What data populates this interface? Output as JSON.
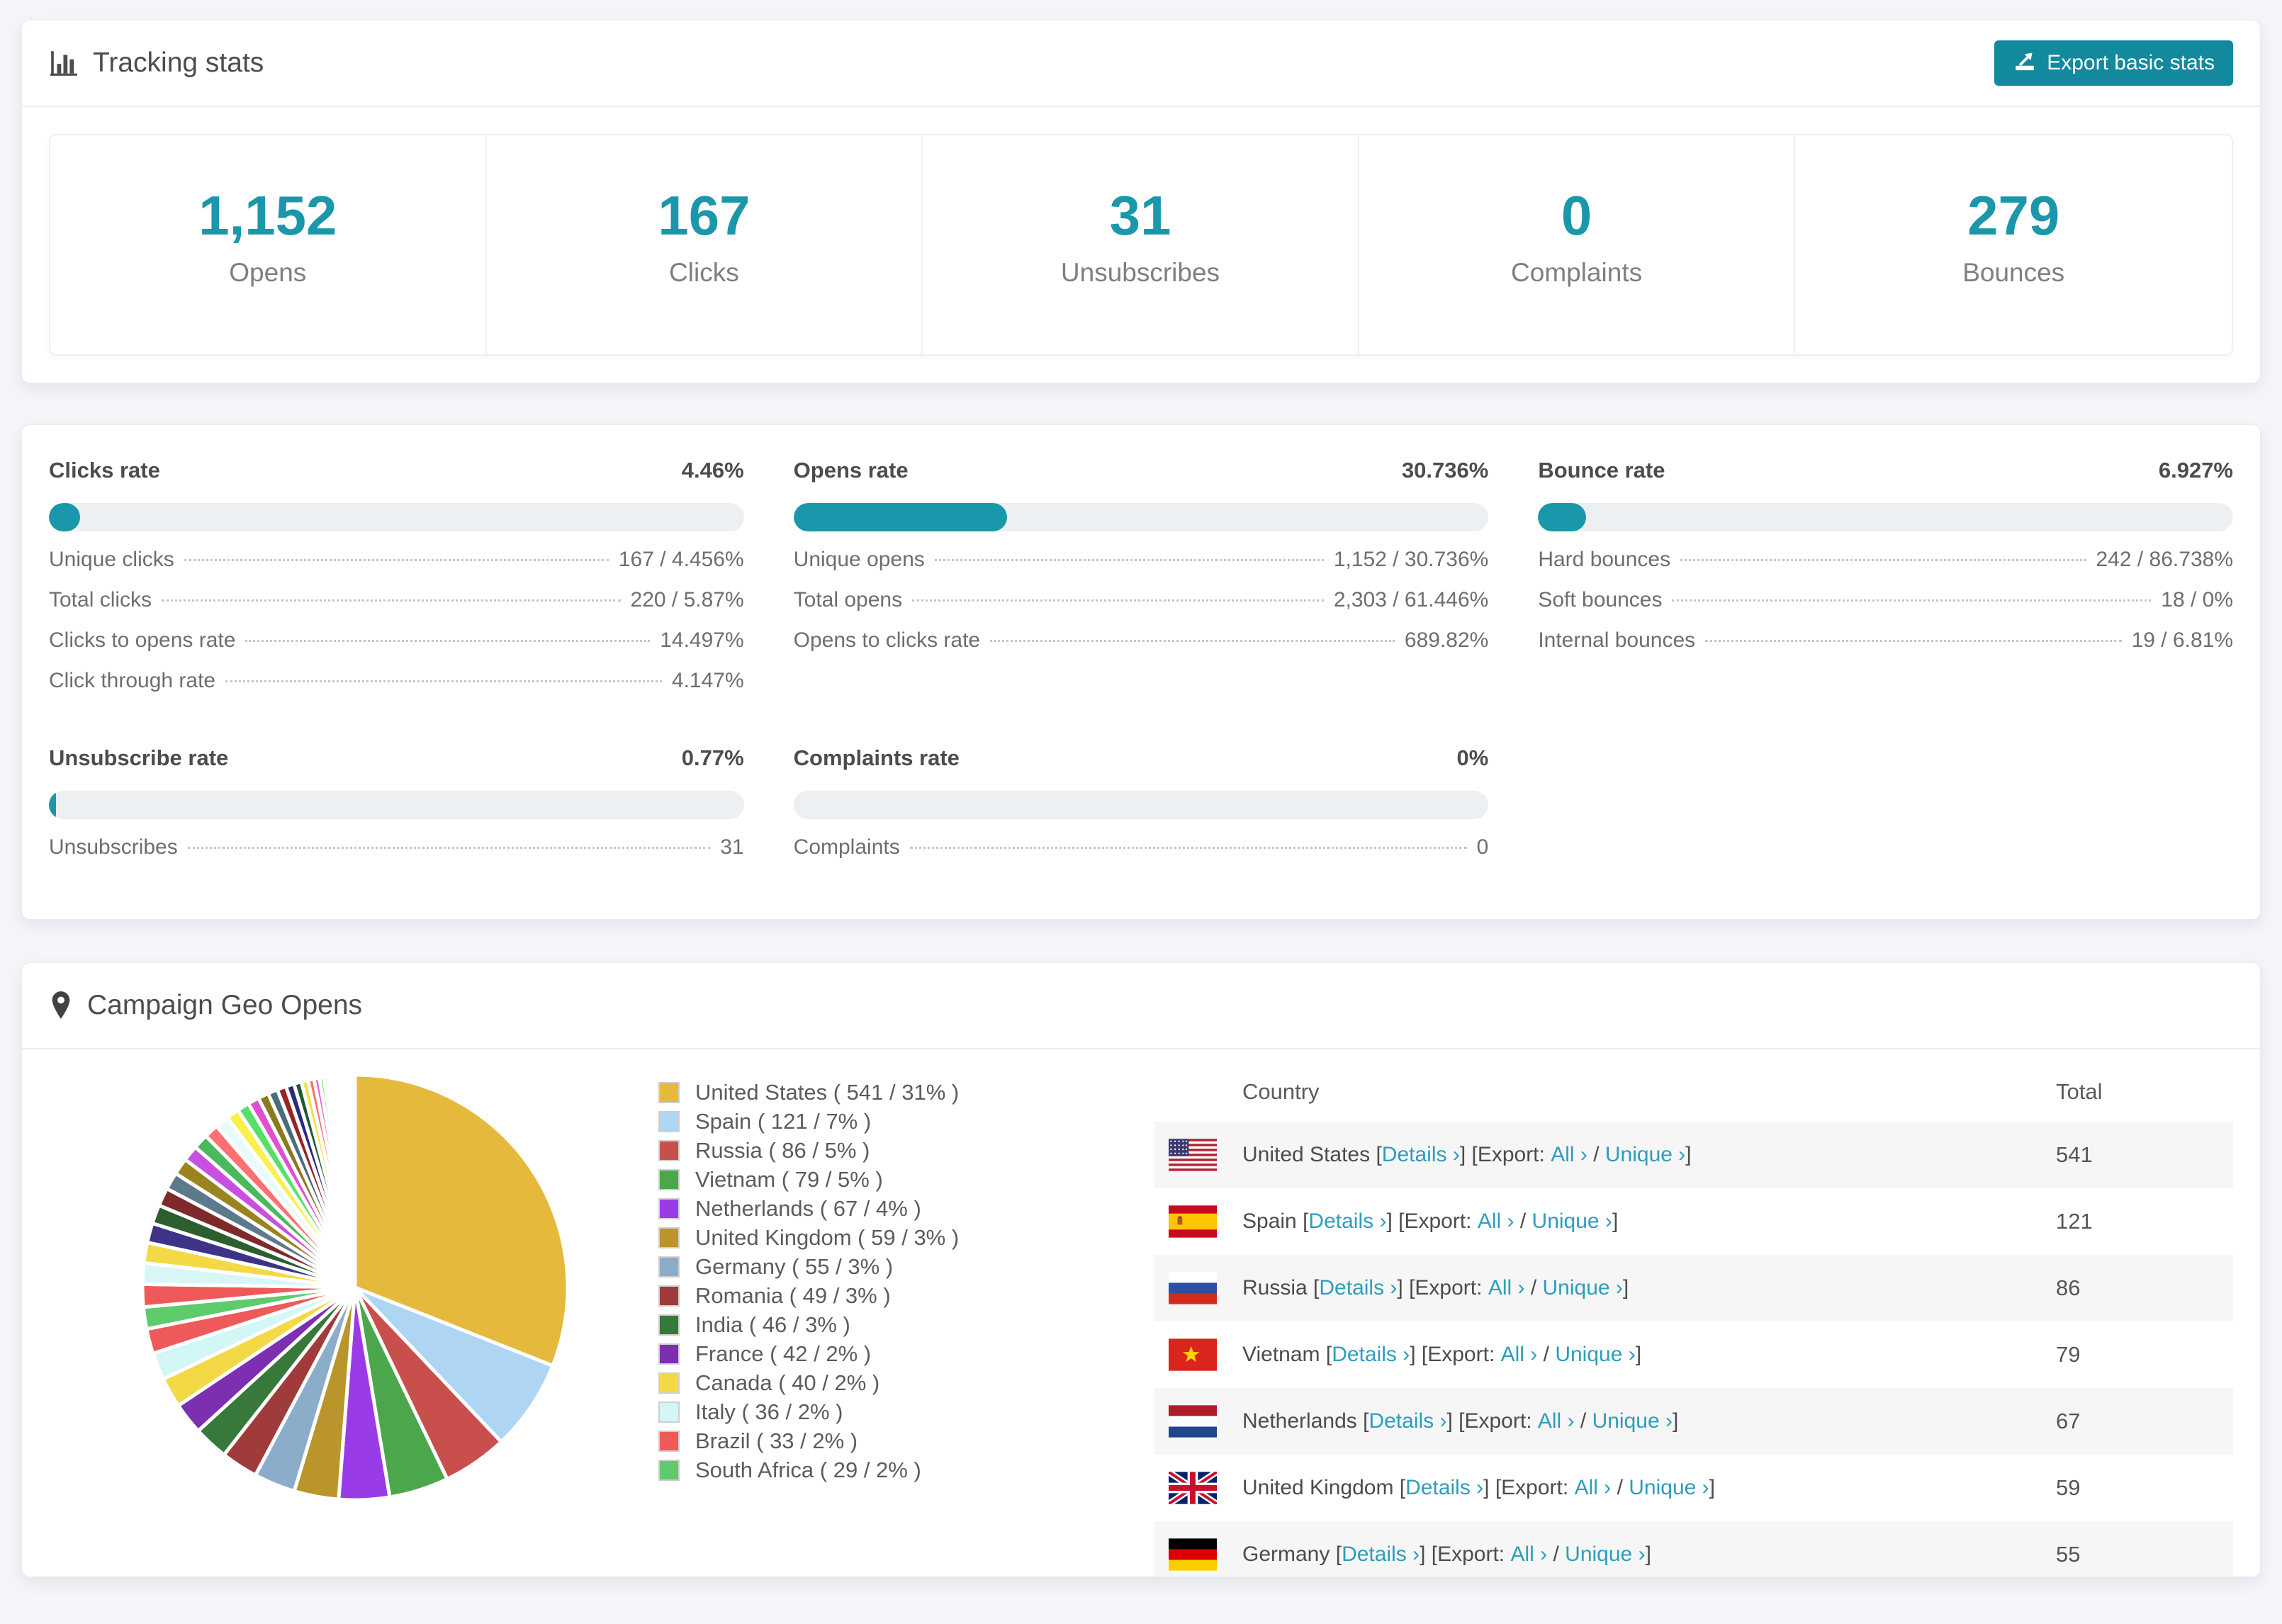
{
  "colors": {
    "accent_teal": "#1b97ab",
    "button_teal": "#12899d",
    "link_teal": "#2d9dbd",
    "bar_track": "#edf0f2",
    "page_background": "#f4f6f9"
  },
  "tracking": {
    "title": "Tracking stats",
    "export_label": "Export basic stats",
    "stats": [
      {
        "value": "1,152",
        "label": "Opens"
      },
      {
        "value": "167",
        "label": "Clicks"
      },
      {
        "value": "31",
        "label": "Unsubscribes"
      },
      {
        "value": "0",
        "label": "Complaints"
      },
      {
        "value": "279",
        "label": "Bounces"
      }
    ]
  },
  "rates": {
    "clicks": {
      "title": "Clicks rate",
      "value": "4.46%",
      "percent": 4.46,
      "rows": [
        {
          "label": "Unique clicks",
          "value": "167 / 4.456%"
        },
        {
          "label": "Total clicks",
          "value": "220 / 5.87%"
        },
        {
          "label": "Clicks to opens rate",
          "value": "14.497%"
        },
        {
          "label": "Click through rate",
          "value": "4.147%"
        }
      ]
    },
    "opens": {
      "title": "Opens rate",
      "value": "30.736%",
      "percent": 30.736,
      "rows": [
        {
          "label": "Unique opens",
          "value": "1,152 / 30.736%"
        },
        {
          "label": "Total opens",
          "value": "2,303 / 61.446%"
        },
        {
          "label": "Opens to clicks rate",
          "value": "689.82%"
        }
      ]
    },
    "bounce": {
      "title": "Bounce rate",
      "value": "6.927%",
      "percent": 6.927,
      "rows": [
        {
          "label": "Hard bounces",
          "value": "242 / 86.738%"
        },
        {
          "label": "Soft bounces",
          "value": "18 / 0%"
        },
        {
          "label": "Internal bounces",
          "value": "19 / 6.81%"
        }
      ]
    },
    "unsubscribe": {
      "title": "Unsubscribe rate",
      "value": "0.77%",
      "percent": 0.77,
      "rows": [
        {
          "label": "Unsubscribes",
          "value": "31"
        }
      ]
    },
    "complaints": {
      "title": "Complaints rate",
      "value": "0%",
      "percent": 0,
      "rows": [
        {
          "label": "Complaints",
          "value": "0"
        }
      ]
    }
  },
  "geo": {
    "title": "Campaign Geo Opens",
    "table": {
      "columns": [
        "Country",
        "Total"
      ],
      "link_labels": {
        "details": "Details ›",
        "export": "[Export:",
        "all": "All ›",
        "unique": "Unique ›"
      },
      "rows": [
        {
          "name": "United States",
          "total": "541",
          "flag": "us"
        },
        {
          "name": "Spain",
          "total": "121",
          "flag": "es"
        },
        {
          "name": "Russia",
          "total": "86",
          "flag": "ru"
        },
        {
          "name": "Vietnam",
          "total": "79",
          "flag": "vn"
        },
        {
          "name": "Netherlands",
          "total": "67",
          "flag": "nl"
        },
        {
          "name": "United Kingdom",
          "total": "59",
          "flag": "gb"
        },
        {
          "name": "Germany",
          "total": "55",
          "flag": "de"
        }
      ]
    }
  },
  "chart_data": {
    "type": "pie",
    "title": "Campaign Geo Opens",
    "legend_position": "right",
    "start_angle_deg": 0,
    "direction": "clockwise",
    "labels": [
      "United States",
      "Spain",
      "Russia",
      "Vietnam",
      "Netherlands",
      "United Kingdom",
      "Germany",
      "Romania",
      "India",
      "France",
      "Canada",
      "Italy",
      "Brazil",
      "South Africa"
    ],
    "values": [
      541,
      121,
      86,
      79,
      67,
      59,
      55,
      49,
      46,
      42,
      40,
      36,
      33,
      29
    ],
    "percents": [
      31,
      7,
      5,
      5,
      4,
      3,
      3,
      3,
      3,
      2,
      2,
      2,
      2,
      2
    ],
    "colors": [
      "#e5b93c",
      "#aed5f2",
      "#c94f4d",
      "#4ca64c",
      "#9a3be8",
      "#b9952c",
      "#8cadca",
      "#a03b3b",
      "#38783a",
      "#7c2fb0",
      "#f3d945",
      "#d3f6f6",
      "#ee5a5a",
      "#5ecb6c"
    ],
    "other_slices_estimated": [
      30,
      28,
      27,
      26,
      25,
      24,
      23,
      22,
      21,
      20,
      19,
      18,
      17,
      16,
      15,
      14,
      13,
      12,
      11,
      10,
      9,
      8,
      7,
      6,
      5,
      4,
      4,
      3,
      3,
      2,
      2,
      2,
      2,
      1,
      1,
      1,
      1,
      1,
      1,
      1,
      1,
      1,
      1,
      1,
      1,
      1,
      1
    ],
    "other_colors": [
      "#ee5a5a",
      "#d9f6f6",
      "#f3d945",
      "#3d3488",
      "#2c5e2e",
      "#7e2a2a",
      "#5d7a8c",
      "#9a8420",
      "#c94fe0",
      "#4cb85c",
      "#ff7070",
      "#e8fbfb",
      "#f7f04d",
      "#55e06a",
      "#e04fd0",
      "#8a7a1e",
      "#4a6b7c",
      "#992222",
      "#2a2a80",
      "#1e5c2e",
      "#f3e04a",
      "#ff6b6b",
      "#ee55cc",
      "#7de87d",
      "#c9a227",
      "#aed5f2",
      "#c94f4d",
      "#4ca64c",
      "#9a3be8",
      "#b9952c"
    ]
  }
}
